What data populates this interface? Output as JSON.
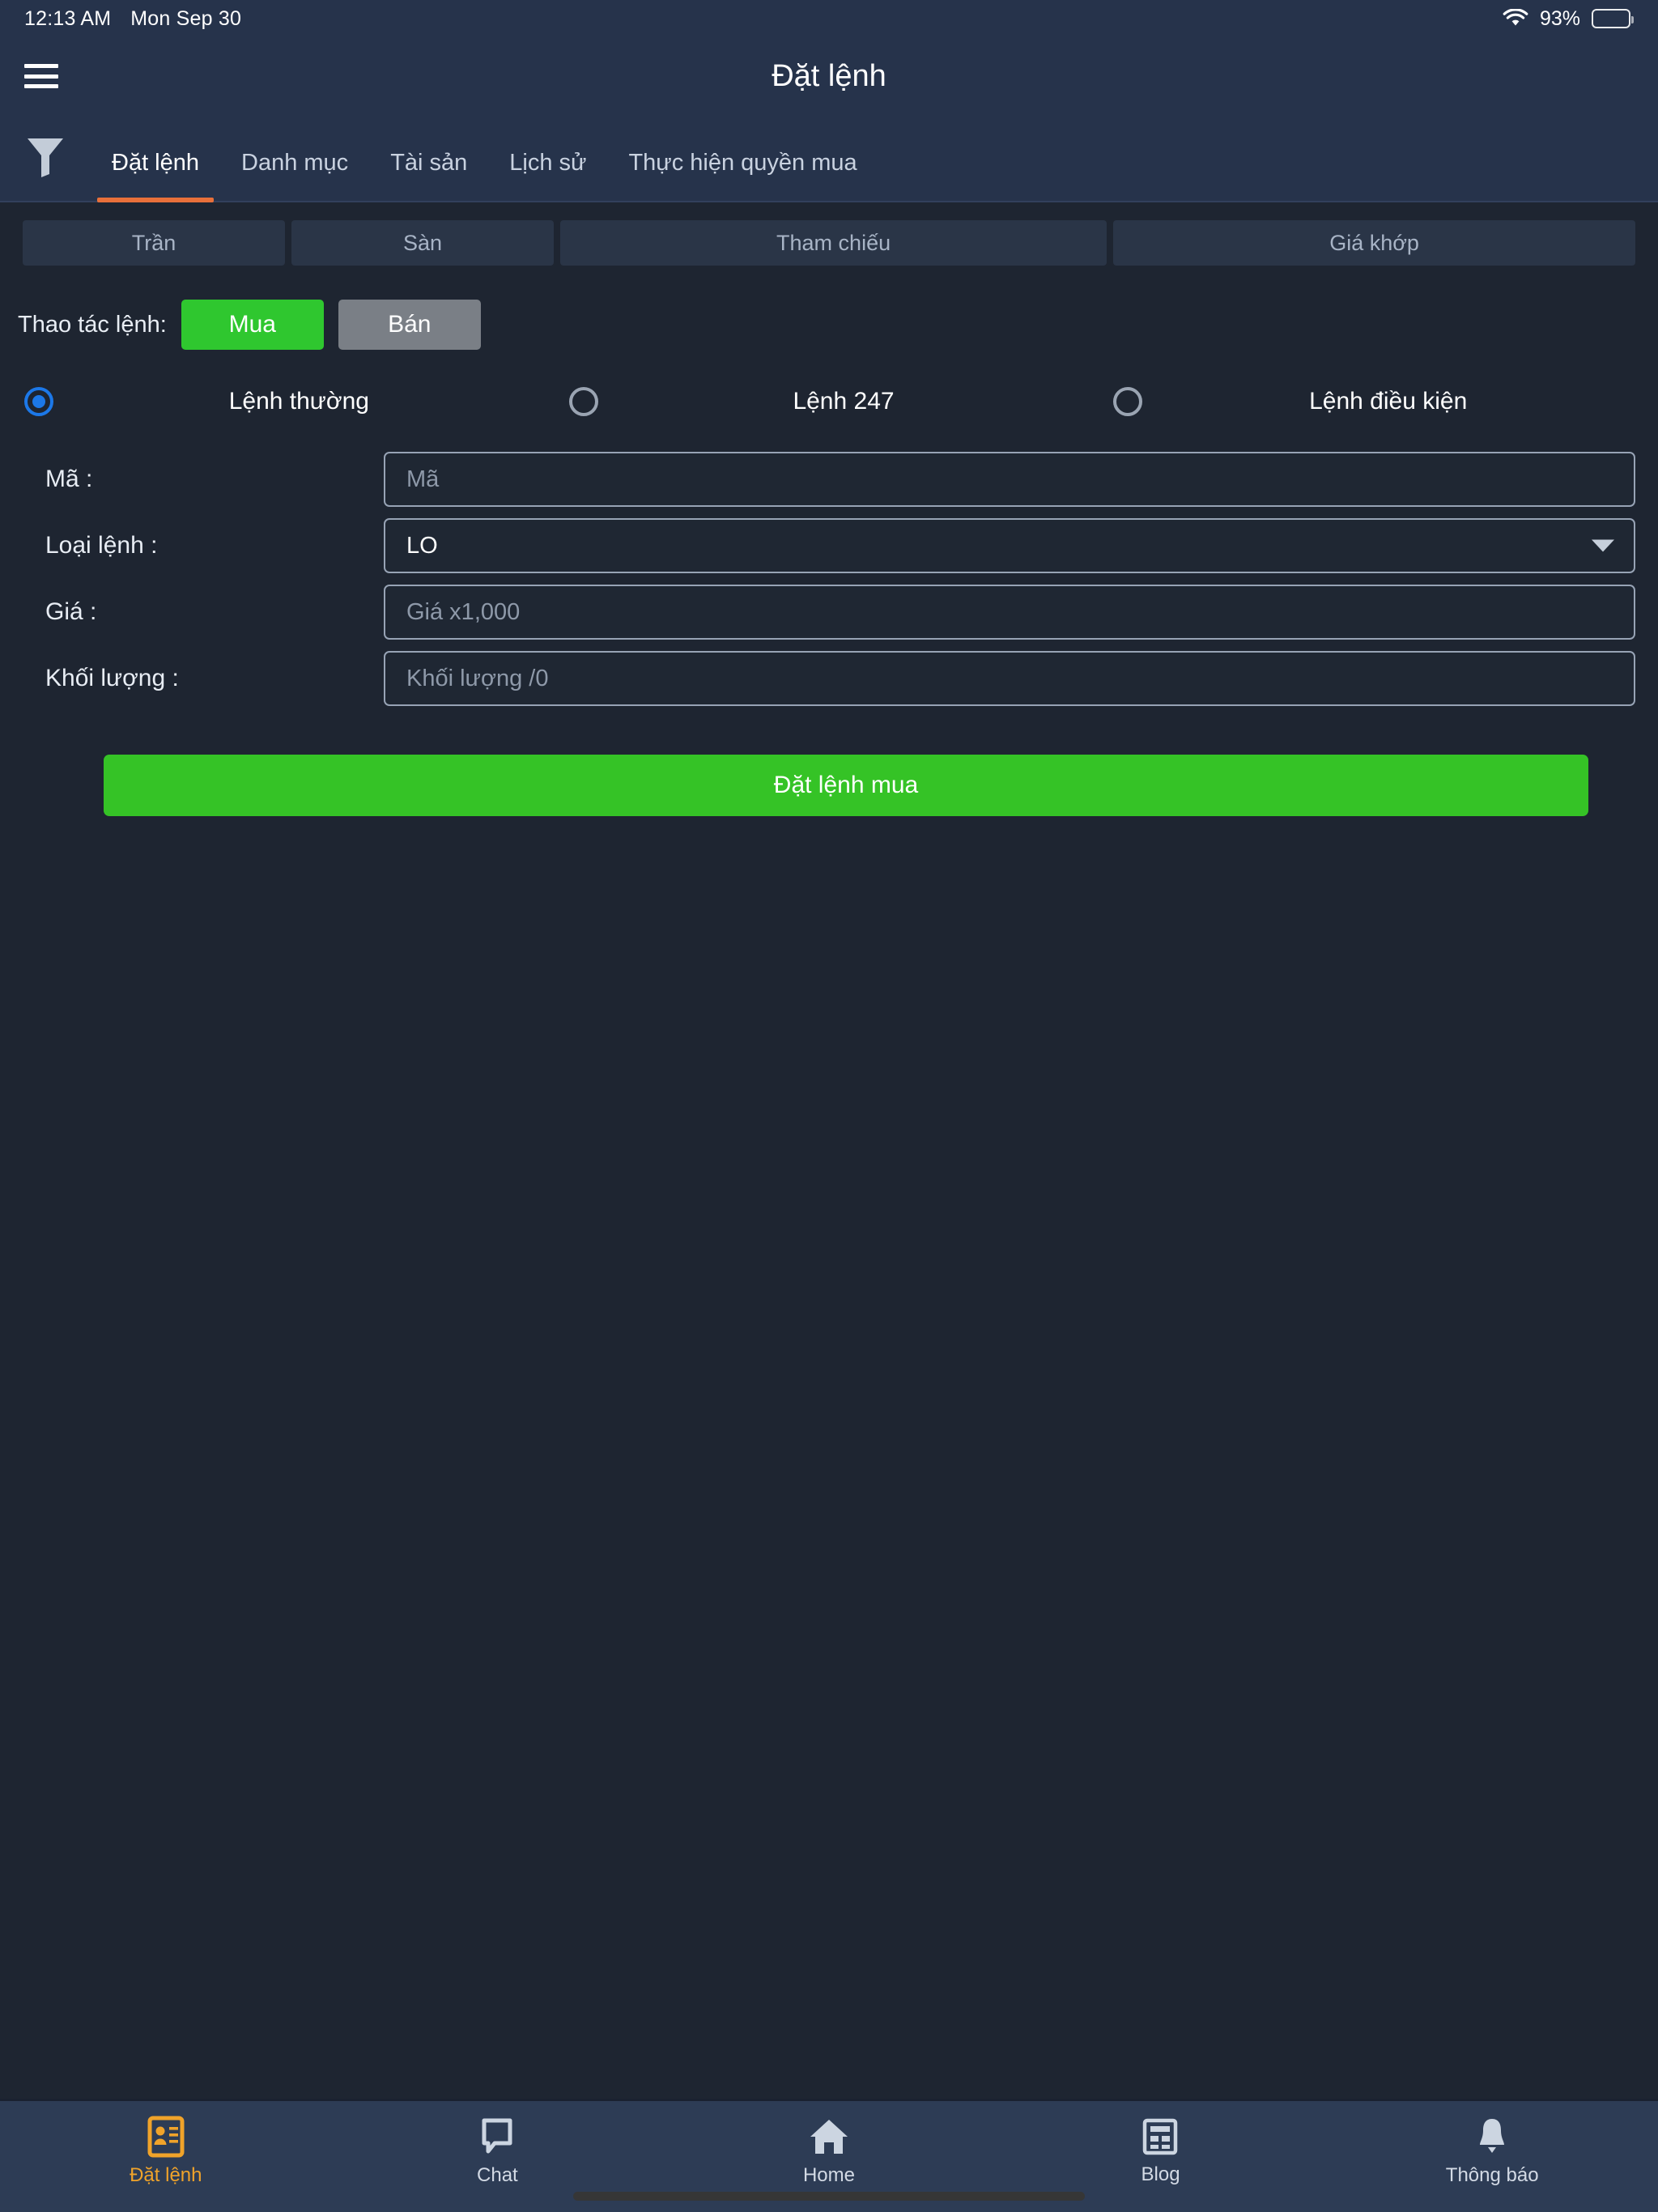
{
  "status_bar": {
    "time": "12:13 AM",
    "date": "Mon Sep 30",
    "battery_percent": "93%",
    "wifi_icon": "wifi-icon",
    "battery_icon": "battery-icon"
  },
  "header": {
    "menu_icon": "hamburger-menu-icon",
    "title": "Đặt lệnh"
  },
  "tabbar": {
    "filter_icon": "filter-funnel-icon",
    "active_index": 0,
    "accent_color": "#e8703a",
    "tabs": [
      {
        "label": "Đặt lệnh"
      },
      {
        "label": "Danh mục"
      },
      {
        "label": "Tài sản"
      },
      {
        "label": "Lịch sử"
      },
      {
        "label": "Thực hiện quyền mua"
      }
    ]
  },
  "price_row": {
    "cells": [
      {
        "label": "Trần"
      },
      {
        "label": "Sàn"
      },
      {
        "label": "Tham chiếu"
      },
      {
        "label": "Giá khớp"
      }
    ]
  },
  "order_action": {
    "label": "Thao tác lệnh:",
    "buy_label": "Mua",
    "sell_label": "Bán",
    "selected": "Mua",
    "buy_color": "#2fc72f",
    "sell_color": "#7a7f86"
  },
  "order_type": {
    "selected_index": 0,
    "radio_color": "#1c78e8",
    "options": [
      {
        "label": "Lệnh thường",
        "checked": true
      },
      {
        "label": "Lệnh 247",
        "checked": false
      },
      {
        "label": "Lệnh điều kiện",
        "checked": false
      }
    ]
  },
  "form": {
    "symbol": {
      "label": "Mã :",
      "value": "",
      "placeholder": "Mã"
    },
    "order_type": {
      "label": "Loại lệnh :",
      "value": "LO",
      "chevron_icon": "chevron-down-icon"
    },
    "price": {
      "label": "Giá :",
      "value": "",
      "placeholder": "Giá x1,000"
    },
    "volume": {
      "label": "Khối lượng :",
      "value": "",
      "placeholder": "Khối lượng /0"
    }
  },
  "submit": {
    "label": "Đặt lệnh mua",
    "color": "#35c326"
  },
  "bottom_nav": {
    "active_index": 0,
    "active_color": "#f0a32a",
    "items": [
      {
        "label": "Đặt lệnh",
        "icon": "id-card-icon",
        "active": true
      },
      {
        "label": "Chat",
        "icon": "chat-bubble-icon",
        "active": false
      },
      {
        "label": "Home",
        "icon": "home-icon",
        "active": false
      },
      {
        "label": "Blog",
        "icon": "newspaper-icon",
        "active": false
      },
      {
        "label": "Thông báo",
        "icon": "bell-icon",
        "active": false
      }
    ]
  }
}
